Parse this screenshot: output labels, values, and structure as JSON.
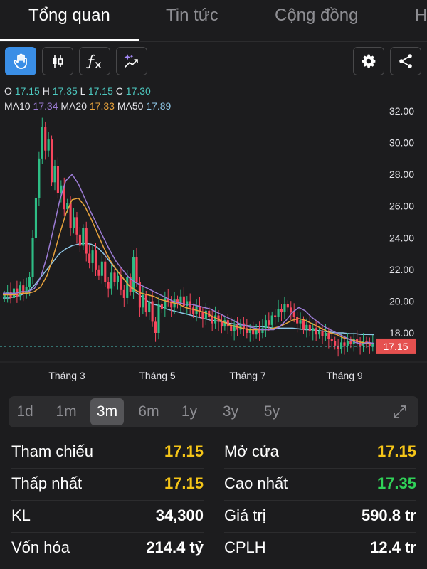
{
  "tabs": [
    {
      "label": "Tổng quan",
      "active": true
    },
    {
      "label": "Tin tức",
      "active": false
    },
    {
      "label": "Cộng đồng",
      "active": false
    },
    {
      "label": "H",
      "active": false
    }
  ],
  "toolbar": {
    "buttons": [
      "hand-icon",
      "candlestick-icon",
      "function-icon",
      "ai-sparkle-icon"
    ],
    "right_buttons": [
      "gear-icon",
      "share-icon"
    ],
    "active_color": "#3a8ee6"
  },
  "ohlc": {
    "o_label": "O",
    "o_value": "17.15",
    "h_label": "H",
    "h_value": "17.35",
    "l_label": "L",
    "l_value": "17.15",
    "c_label": "C",
    "c_value": "17.30"
  },
  "ma": {
    "ma10_label": "MA10",
    "ma10_value": "17.34",
    "ma20_label": "MA20",
    "ma20_value": "17.33",
    "ma50_label": "MA50",
    "ma50_value": "17.89"
  },
  "chart_data": {
    "type": "candlestick",
    "yaxis_ticks": [
      "32.00",
      "30.00",
      "28.00",
      "26.00",
      "24.00",
      "22.00",
      "20.00",
      "18.00"
    ],
    "ylim": [
      16.0,
      33.0
    ],
    "xaxis_ticks": [
      "Tháng 3",
      "Tháng 5",
      "Tháng 7",
      "Tháng 9"
    ],
    "current_price_label": "17.15",
    "current_price": 17.15,
    "colors": {
      "up": "#2ebd85",
      "down": "#f6465d",
      "ma10": "#9b7bd4",
      "ma20": "#e8a33d",
      "ma50": "#8fc8e8",
      "price_tag": "#e5504f"
    },
    "closes": [
      20.4,
      20.6,
      20.2,
      20.8,
      20.3,
      21.0,
      20.5,
      20.9,
      21.5,
      24.0,
      26.5,
      29.0,
      31.0,
      29.5,
      30.2,
      27.5,
      28.5,
      26.8,
      27.3,
      25.8,
      26.2,
      24.6,
      25.3,
      24.2,
      23.5,
      24.6,
      23.0,
      22.4,
      23.2,
      22.0,
      21.6,
      22.5,
      21.2,
      20.8,
      21.8,
      21.2,
      21.6,
      20.7,
      20.2,
      21.5,
      20.6,
      22.8,
      21.2,
      19.6,
      20.4,
      19.3,
      20.0,
      18.7,
      18.0,
      19.8,
      19.5,
      20.2,
      20.0,
      19.6,
      20.1,
      19.8,
      20.3,
      19.7,
      20.0,
      19.6,
      19.2,
      19.7,
      19.3,
      18.9,
      19.4,
      19.0,
      18.6,
      19.1,
      18.7,
      18.4,
      18.8,
      18.4,
      18.1,
      18.5,
      18.2,
      18.6,
      18.3,
      18.0,
      18.2,
      17.9,
      18.3,
      18.0,
      18.3,
      18.8,
      18.5,
      19.1,
      19.0,
      19.5,
      19.3,
      19.8,
      19.6,
      19.3,
      19.0,
      18.6,
      18.8,
      18.2,
      18.5,
      18.1,
      18.3,
      17.9,
      18.1,
      17.8,
      18.0,
      17.6,
      17.5,
      17.2,
      17.0,
      17.4,
      17.2,
      17.5,
      17.3,
      17.6,
      17.4,
      17.2,
      17.5,
      17.3,
      17.15,
      17.3
    ],
    "ma10": [
      20.5,
      20.5,
      20.5,
      20.6,
      20.6,
      20.8,
      21.5,
      22.8,
      24.5,
      26.3,
      27.6,
      28.0,
      27.4,
      26.5,
      25.6,
      24.8,
      24.0,
      23.2,
      22.5,
      22.0,
      21.5,
      21.2,
      21.0,
      20.8,
      20.6,
      20.4,
      20.2,
      20.0,
      19.9,
      19.8,
      19.8,
      19.7,
      19.6,
      19.5,
      19.3,
      19.1,
      18.9,
      18.7,
      18.5,
      18.4,
      18.3,
      18.2,
      18.2,
      18.2,
      18.4,
      18.8,
      19.3,
      19.6,
      19.4,
      19.0,
      18.7,
      18.4,
      18.2,
      18.0,
      17.8,
      17.6,
      17.4,
      17.3,
      17.4,
      17.34
    ],
    "ma20": [
      20.4,
      20.4,
      20.4,
      20.5,
      20.5,
      20.6,
      20.9,
      21.6,
      22.8,
      24.2,
      25.5,
      26.4,
      26.5,
      26.0,
      25.2,
      24.3,
      23.4,
      22.6,
      22.0,
      21.5,
      21.0,
      20.7,
      20.5,
      20.4,
      20.3,
      20.1,
      20.0,
      19.9,
      19.8,
      19.6,
      19.5,
      19.4,
      19.3,
      19.1,
      18.9,
      18.7,
      18.5,
      18.4,
      18.3,
      18.2,
      18.2,
      18.2,
      18.2,
      18.3,
      18.4,
      18.6,
      18.8,
      18.9,
      18.8,
      18.6,
      18.4,
      18.2,
      18.0,
      17.9,
      17.7,
      17.6,
      17.5,
      17.4,
      17.35,
      17.33
    ],
    "ma50": [
      20.2,
      20.2,
      20.3,
      20.4,
      20.6,
      21.0,
      21.5,
      22.0,
      22.5,
      23.0,
      23.3,
      23.5,
      23.6,
      23.65,
      23.6,
      23.4,
      23.0,
      22.5,
      22.0,
      21.5,
      21.0,
      20.6,
      20.3,
      20.0,
      19.8,
      19.7,
      19.5,
      19.4,
      19.3,
      19.2,
      19.1,
      19.0,
      18.9,
      18.8,
      18.75,
      18.7,
      18.6,
      18.55,
      18.5,
      18.45,
      18.4,
      18.4,
      18.35,
      18.3,
      18.3,
      18.3,
      18.3,
      18.25,
      18.2,
      18.2,
      18.15,
      18.1,
      18.05,
      18.0,
      18.0,
      17.95,
      17.95,
      17.9,
      17.9,
      17.89
    ]
  },
  "ranges": [
    {
      "label": "1d",
      "active": false
    },
    {
      "label": "1m",
      "active": false
    },
    {
      "label": "3m",
      "active": true
    },
    {
      "label": "6m",
      "active": false
    },
    {
      "label": "1y",
      "active": false
    },
    {
      "label": "3y",
      "active": false
    },
    {
      "label": "5y",
      "active": false
    }
  ],
  "stats": {
    "left": [
      {
        "label": "Tham chiếu",
        "value": "17.15",
        "color": "#f5c518"
      },
      {
        "label": "Thấp nhất",
        "value": "17.15",
        "color": "#f5c518"
      },
      {
        "label": "KL",
        "value": "34,300",
        "color": "#ffffff"
      },
      {
        "label": "Vốn hóa",
        "value": "214.4 tỷ",
        "color": "#ffffff"
      }
    ],
    "right": [
      {
        "label": "Mở cửa",
        "value": "17.15",
        "color": "#f5c518"
      },
      {
        "label": "Cao nhất",
        "value": "17.35",
        "color": "#30d158"
      },
      {
        "label": "Giá trị",
        "value": "590.8 tr",
        "color": "#ffffff"
      },
      {
        "label": "CPLH",
        "value": "12.4 tr",
        "color": "#ffffff"
      }
    ]
  }
}
